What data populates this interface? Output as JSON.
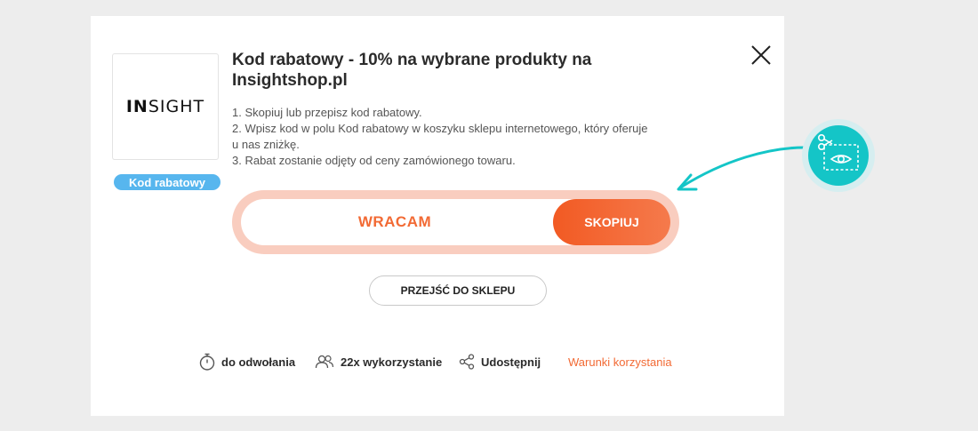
{
  "modal": {
    "logo_text_bold": "IN",
    "logo_text_rest": "SIGHT",
    "badge": "Kod rabatowy",
    "title": "Kod rabatowy - 10% na wybrane produkty na Insightshop.pl",
    "instructions": [
      "1. Skopiuj lub przepisz kod rabatowy.",
      "2. Wpisz kod w polu Kod rabatowy w koszyku sklepu internetowego, który oferuje u nas zniżkę.",
      "3. Rabat zostanie odjęty od ceny zamówionego towaru."
    ],
    "code_value": "WRACAM",
    "copy_button": "SKOPIUJ",
    "shop_button": "PRZEJŚĆ DO SKLEPU",
    "footer": {
      "validity": "do odwołania",
      "usage": "22x wykorzystanie",
      "share": "Udostępnij",
      "terms": "Warunki korzystania"
    }
  },
  "colors": {
    "accent": "#f26a34",
    "badge": "#57b6ee",
    "teal": "#14c5c7",
    "code_ring": "#f9cdbf"
  },
  "icons": [
    "close-icon",
    "stopwatch-icon",
    "users-icon",
    "share-icon",
    "scissors-coupon-icon",
    "curved-arrow-icon"
  ]
}
